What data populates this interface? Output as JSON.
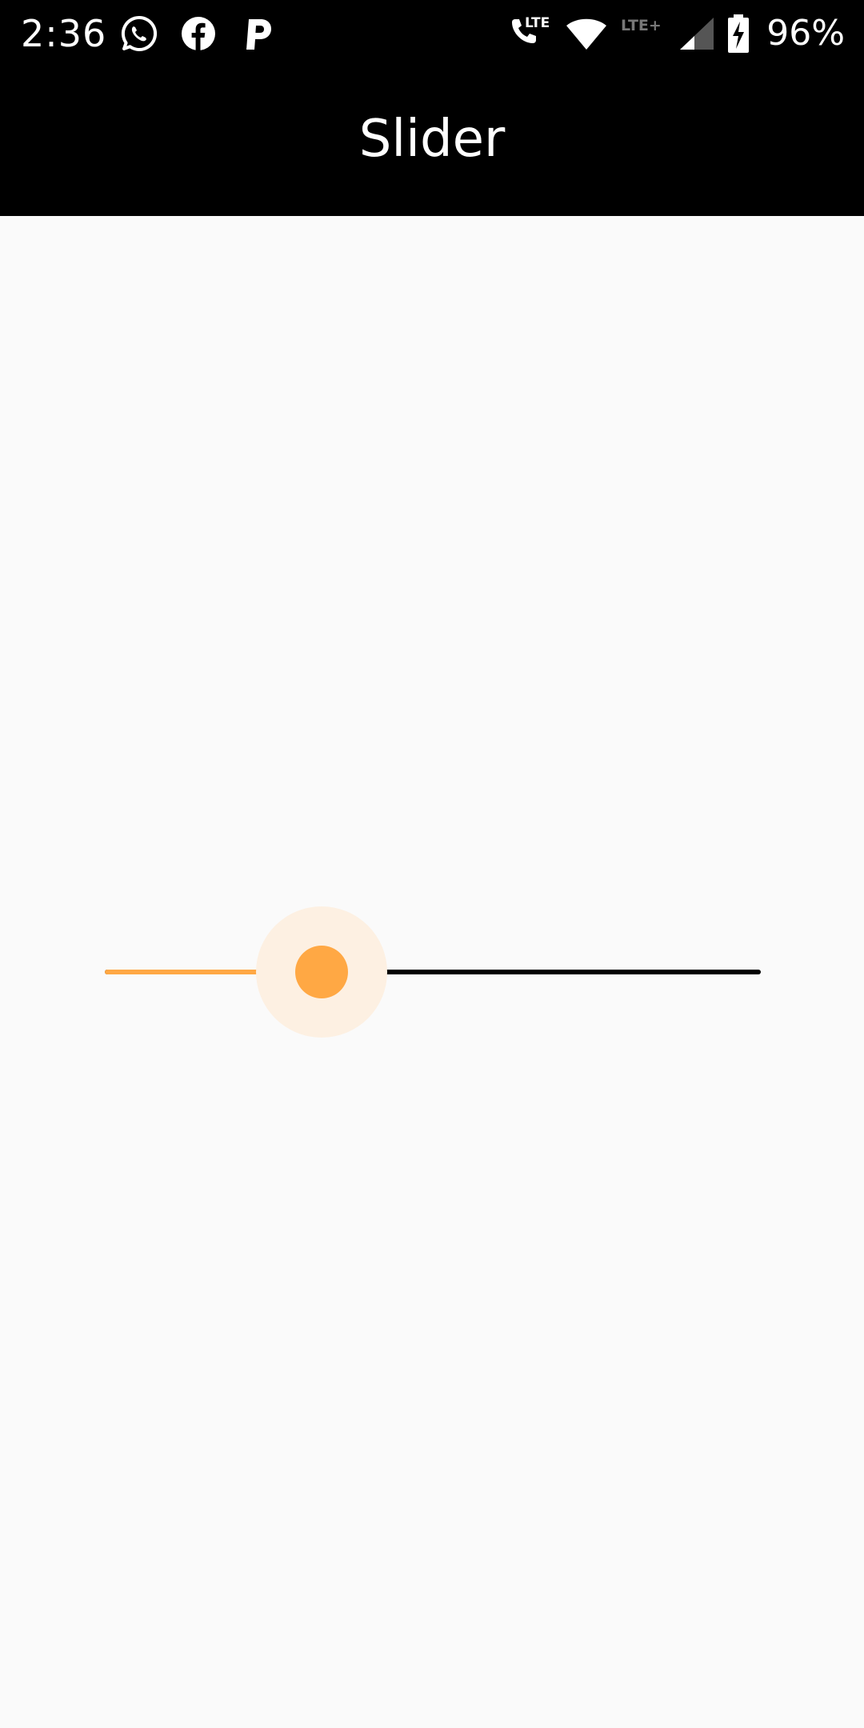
{
  "status_bar": {
    "time": "2:36",
    "battery_text": "96%",
    "left_icons": [
      "whatsapp-icon",
      "facebook-icon",
      "p-app-icon"
    ],
    "right_icons": [
      "volte-call-icon",
      "wifi-icon",
      "lte-plus-icon",
      "cell-signal-icon",
      "battery-charging-icon"
    ],
    "network_labels": {
      "call": "LTE",
      "data": "LTE+"
    }
  },
  "app_bar": {
    "title": "Slider"
  },
  "slider": {
    "value_fraction": 0.33,
    "active_color": "#ffa844",
    "inactive_color": "#000000",
    "halo_color": "#fdf0e2"
  },
  "colors": {
    "background": "#fafafa",
    "app_bar": "#000000",
    "accent": "#ffa844"
  }
}
